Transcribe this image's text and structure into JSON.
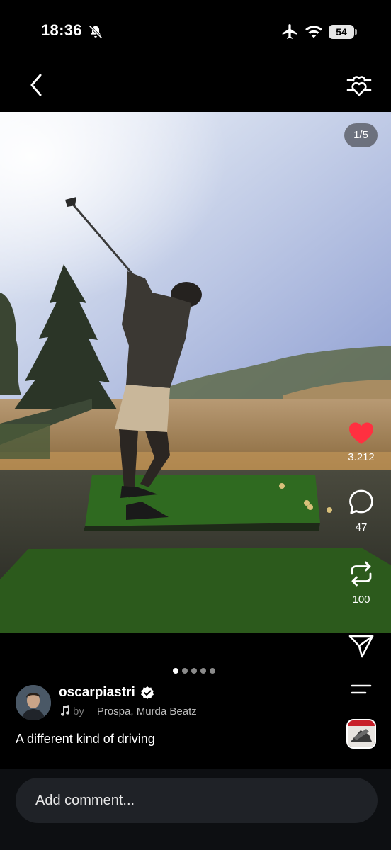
{
  "status_bar": {
    "time": "18:36",
    "battery": "54",
    "icons": [
      "bell-slash-icon",
      "airplane-icon",
      "wifi-icon",
      "battery-icon"
    ]
  },
  "nav": {
    "back_icon": "chevron-left-icon",
    "filter_icon": "sliders-heart-icon"
  },
  "post": {
    "counter": "1/5",
    "page_index": 1,
    "page_count": 5,
    "username": "oscarpiastri",
    "verified": true,
    "music": {
      "by": "by",
      "artists": "Prospa, Murda Beatz"
    },
    "caption": "A different kind of driving"
  },
  "actions": {
    "like_count": "3.212",
    "comment_count": "47",
    "repost_count": "100",
    "like_color": "#ff3040"
  },
  "comment": {
    "placeholder": "Add comment..."
  }
}
